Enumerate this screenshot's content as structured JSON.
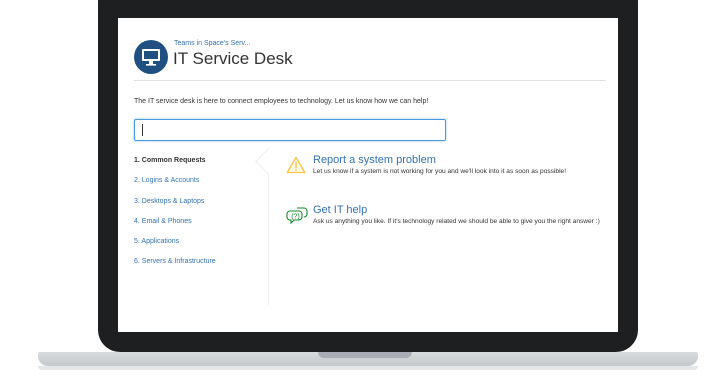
{
  "header": {
    "breadcrumb": "Teams in Space's Serv...",
    "title": "IT Service Desk",
    "logo_icon": "monitor-icon",
    "accent_color": "#205081"
  },
  "intro": {
    "text": "The IT service desk is here to connect employees to technology. Let us know how we can help!"
  },
  "search": {
    "value": "",
    "placeholder": ""
  },
  "sidebar": {
    "items": [
      {
        "label": "1. Common Requests",
        "active": true
      },
      {
        "label": "2. Logins & Accounts",
        "active": false
      },
      {
        "label": "3. Desktops & Laptops",
        "active": false
      },
      {
        "label": "4. Email & Phones",
        "active": false
      },
      {
        "label": "5. Applications",
        "active": false
      },
      {
        "label": "6. Servers & Infrastructure",
        "active": false
      }
    ]
  },
  "requests": [
    {
      "title": "Report a system problem",
      "description": "Let us know if a system is not working for you and we'll look into it as soon as possible!",
      "icon": "warning-icon"
    },
    {
      "title": "Get IT help",
      "description": "Ask us anything you like. If it's technology related we should be able to give you the right answer :)",
      "icon": "question-bubble-icon"
    }
  ],
  "colors": {
    "link": "#3572b0",
    "text": "#333333",
    "warning": "#f6c342",
    "help": "#14892c",
    "bezel": "#1d1f21"
  }
}
